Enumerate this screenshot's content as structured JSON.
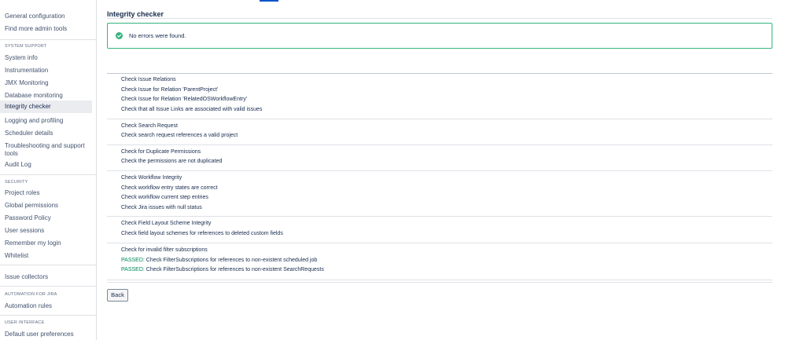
{
  "sidebar": {
    "items_top": [
      {
        "label": "General configuration"
      },
      {
        "label": "Find more admin tools"
      }
    ],
    "system_support": {
      "heading": "SYSTEM SUPPORT",
      "items": [
        {
          "label": "System info"
        },
        {
          "label": "Instrumentation"
        },
        {
          "label": "JMX Monitoring"
        },
        {
          "label": "Database monitoring"
        },
        {
          "label": "Integrity checker",
          "active": true
        },
        {
          "label": "Logging and profiling"
        },
        {
          "label": "Scheduler details"
        },
        {
          "label": "Troubleshooting and support tools"
        },
        {
          "label": "Audit Log"
        }
      ]
    },
    "security": {
      "heading": "SECURITY",
      "items": [
        {
          "label": "Project roles"
        },
        {
          "label": "Global permissions"
        },
        {
          "label": "Password Policy"
        },
        {
          "label": "User sessions"
        },
        {
          "label": "Remember my login"
        },
        {
          "label": "Whitelist"
        }
      ]
    },
    "issue_collectors": {
      "label": "Issue collectors"
    },
    "automation": {
      "heading": "AUTOMATION FOR JIRA",
      "items": [
        {
          "label": "Automation rules"
        }
      ]
    },
    "user_interface": {
      "heading": "USER INTERFACE",
      "items": [
        {
          "label": "Default user preferences"
        }
      ]
    }
  },
  "main": {
    "title": "Integrity checker",
    "message": {
      "text": "No errors were found.",
      "status_color": "#36b37e"
    },
    "groups": [
      {
        "lines": [
          {
            "text": "Check Issue Relations"
          },
          {
            "text": "Check Issue for Relation 'ParentProject'"
          },
          {
            "text": "Check Issue for Relation 'RelatedOSWorkflowEntry'"
          },
          {
            "text": "Check that all Issue Links are associated with valid issues"
          }
        ]
      },
      {
        "lines": [
          {
            "text": "Check Search Request"
          },
          {
            "text": "Check search request references a valid project"
          }
        ]
      },
      {
        "lines": [
          {
            "text": "Check for Duplicate Permissions"
          },
          {
            "text": "Check the permissions are not duplicated"
          }
        ]
      },
      {
        "lines": [
          {
            "text": "Check Workflow Integrity"
          },
          {
            "text": "Check workflow entry states are correct"
          },
          {
            "text": "Check workflow current step entries"
          },
          {
            "text": "Check Jira issues with null status"
          }
        ]
      },
      {
        "lines": [
          {
            "text": "Check Field Layout Scheme Integrity"
          },
          {
            "text": "Check field layout schemes for references to deleted custom fields"
          }
        ]
      },
      {
        "lines": [
          {
            "text": "Check for invalid filter subscriptions"
          },
          {
            "prefix": "PASSED:",
            "text": " Check FilterSubscriptions for references to non-existent scheduled job"
          },
          {
            "prefix": "PASSED:",
            "text": " Check FilterSubscriptions for references to non-existent SearchRequests"
          }
        ]
      }
    ],
    "back_label": "Back"
  },
  "colors": {
    "accent": "#0052cc",
    "success": "#36b37e",
    "passed_text": "#00875a"
  }
}
